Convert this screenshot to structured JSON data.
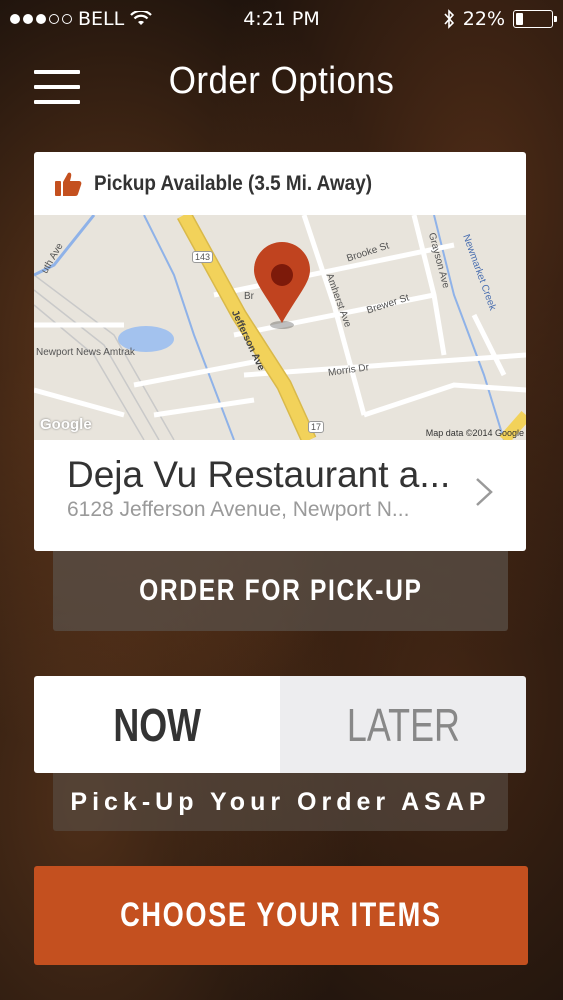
{
  "status_bar": {
    "carrier": "BELL",
    "time": "4:21 PM",
    "battery": "22%",
    "battery_level": 0.22,
    "signal_bars_filled": 3,
    "signal_bars_total": 5
  },
  "header": {
    "title": "Order Options",
    "menu_icon": "hamburger-menu-icon"
  },
  "location_card": {
    "badge": "Pickup Available (3.5 Mi. Away)",
    "badge_icon": "thumbs-up-icon",
    "map": {
      "streets": [
        "Brooke St",
        "Brewer St",
        "Morris Dr",
        "Amherst Ave",
        "Grayson Ave",
        "Jefferson Ave",
        "Newmarket Creek",
        "Newport News Amtrak",
        "uth Ave",
        "Br"
      ],
      "route_shields": [
        "143",
        "17"
      ],
      "attribution": "Map data ©2014 Google",
      "logo": "Google",
      "pin_icon": "map-pin-icon"
    },
    "name": "Deja Vu Restaurant a...",
    "address": "6128 Jefferson Avenue, Newport N...",
    "chevron_icon": "chevron-right-icon"
  },
  "order_type": "ORDER FOR PICK-UP",
  "timing": {
    "now_label": "NOW",
    "later_label": "LATER",
    "selected": "now",
    "subtitle": "Pick-Up Your Order ASAP"
  },
  "cta": "CHOOSE YOUR ITEMS",
  "colors": {
    "accent": "#c4501f",
    "pin": "#c0431f",
    "highway": "#f2d25a"
  }
}
